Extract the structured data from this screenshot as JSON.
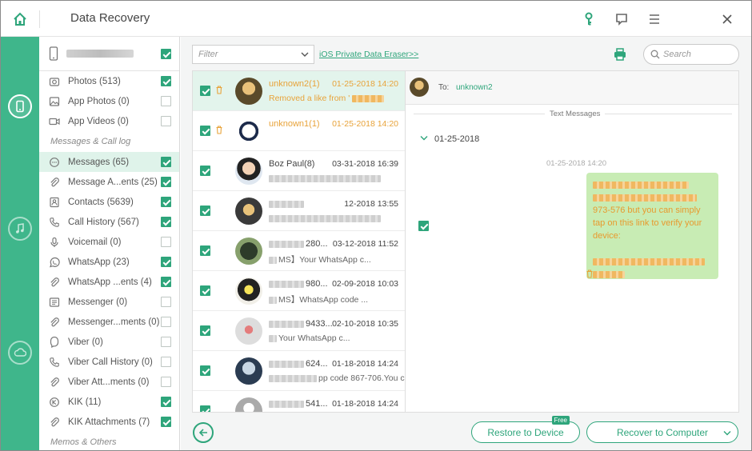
{
  "app": {
    "title": "Data Recovery"
  },
  "colors": {
    "accent": "#2ea57b",
    "rail": "#3fb68b",
    "highlight_text": "#e8a33a",
    "bubble": "#c8ecb4"
  },
  "titlebar": {
    "icons": [
      "home-icon",
      "key-icon",
      "feedback-icon",
      "menu-icon",
      "close-icon"
    ]
  },
  "rail": {
    "items": [
      "phone-device-icon",
      "music-icon",
      "cloud-icon"
    ]
  },
  "sidebar": {
    "device": {
      "checked": true
    },
    "media": [
      {
        "label": "Photos (513)",
        "icon": "photo-icon",
        "checked": true
      },
      {
        "label": "App Photos (0)",
        "icon": "image-icon",
        "checked": false
      },
      {
        "label": "App Videos (0)",
        "icon": "video-icon",
        "checked": false
      }
    ],
    "section_messages": "Messages & Call log",
    "messages": [
      {
        "label": "Messages (65)",
        "icon": "chat-icon",
        "checked": true,
        "active": true
      },
      {
        "label": "Message A...ents (25)",
        "icon": "attachment-icon",
        "checked": true
      },
      {
        "label": "Contacts (5639)",
        "icon": "contact-icon",
        "checked": true
      },
      {
        "label": "Call History (567)",
        "icon": "phone-icon",
        "checked": true
      },
      {
        "label": "Voicemail (0)",
        "icon": "mic-icon",
        "checked": false
      },
      {
        "label": "WhatsApp (23)",
        "icon": "whatsapp-icon",
        "checked": true
      },
      {
        "label": "WhatsApp ...ents (4)",
        "icon": "attachment-icon",
        "checked": true
      },
      {
        "label": "Messenger (0)",
        "icon": "messenger-icon",
        "checked": false
      },
      {
        "label": "Messenger...ments (0)",
        "icon": "attachment-icon",
        "checked": false
      },
      {
        "label": "Viber (0)",
        "icon": "viber-icon",
        "checked": false
      },
      {
        "label": "Viber Call History (0)",
        "icon": "phone-icon",
        "checked": false
      },
      {
        "label": "Viber Att...ments (0)",
        "icon": "attachment-icon",
        "checked": false
      },
      {
        "label": "KIK (11)",
        "icon": "kik-icon",
        "checked": true
      },
      {
        "label": "KIK Attachments (7)",
        "icon": "attachment-icon",
        "checked": true
      }
    ],
    "section_memos": "Memos & Others"
  },
  "toolbar": {
    "filter_placeholder": "Filter",
    "eraser_link": "iOS Private Data Eraser>>",
    "search_placeholder": "Search"
  },
  "conversations": [
    {
      "name": "unknown2(1)",
      "date": "01-25-2018 14:20",
      "preview": "Removed a like from '",
      "highlight": true,
      "active": true,
      "trash": true
    },
    {
      "name": "unknown1(1)",
      "date": "01-25-2018 14:20",
      "preview": "",
      "highlight": true,
      "trash": true
    },
    {
      "name": "Boz Paul(8)",
      "date": "03-31-2018 16:39",
      "preview": ""
    },
    {
      "name": "",
      "date": "12-2018 13:55",
      "preview": ""
    },
    {
      "name": "280...",
      "date": "03-12-2018 11:52",
      "preview": "MS】Your WhatsApp c..."
    },
    {
      "name": "980...",
      "date": "02-09-2018 10:03",
      "preview": "MS】WhatsApp code ..."
    },
    {
      "name": "9433...",
      "date": "02-10-2018 10:35",
      "preview": "Your WhatsApp c..."
    },
    {
      "name": "624...",
      "date": "01-18-2018 14:24",
      "preview": "pp code 867-706.You c..."
    },
    {
      "name": "541...",
      "date": "01-18-2018 14:24",
      "preview": ""
    }
  ],
  "detail": {
    "to_label": "To:",
    "to_name": "unknown2",
    "section": "Text Messages",
    "date_group": "01-25-2018",
    "message_time": "01-25-2018 14:20",
    "message_text_1": "973-576 but you can simply tap on this link to verify your device:",
    "message_checked": true
  },
  "footer": {
    "restore_label": "Restore to Device",
    "free_badge": "Free",
    "recover_label": "Recover to Computer"
  }
}
